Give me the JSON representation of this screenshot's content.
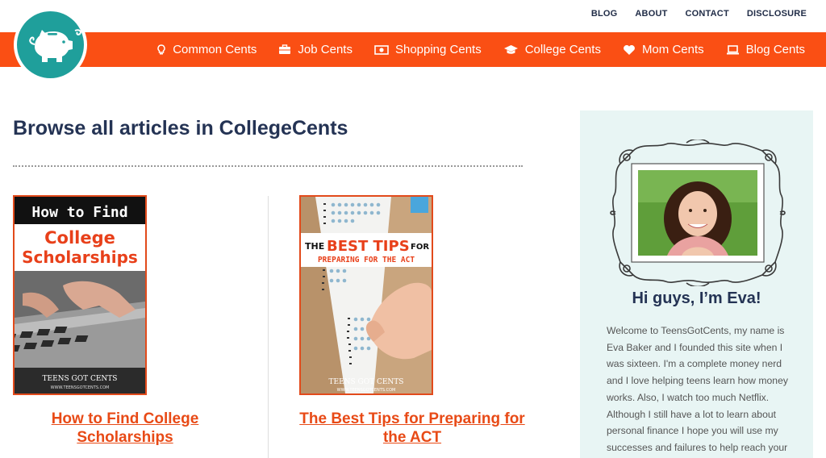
{
  "top_links": [
    "BLOG",
    "ABOUT",
    "CONTACT",
    "DISCLOSURE"
  ],
  "nav": [
    {
      "label": "Common Cents",
      "icon": "lightbulb-icon"
    },
    {
      "label": "Job Cents",
      "icon": "briefcase-icon"
    },
    {
      "label": "Shopping Cents",
      "icon": "money-icon"
    },
    {
      "label": "College Cents",
      "icon": "graduation-cap-icon"
    },
    {
      "label": "Mom Cents",
      "icon": "heart-icon"
    },
    {
      "label": "Blog Cents",
      "icon": "laptop-icon"
    }
  ],
  "colors": {
    "brand_orange": "#fa4f14",
    "logo_teal": "#1f9f9b",
    "title_navy": "#243354",
    "link_orange": "#e84a16",
    "sidebar_bg": "#e8f5f4"
  },
  "page_title": "Browse all articles in CollegeCents",
  "articles": [
    {
      "title": "How to Find College Scholarships",
      "image": {
        "line1": "How to Find",
        "line2": "College",
        "line3": "Scholarships",
        "brand": "TEENS GOT CENTS",
        "url": "WWW.TEENSGOTCENTS.COM"
      }
    },
    {
      "title": "The Best Tips for Preparing for the ACT",
      "image": {
        "the": "THE",
        "best_tips": "BEST TIPS",
        "for": "FOR",
        "line2": "PREPARING FOR THE ACT",
        "brand": "TEENS GOT CENTS",
        "url": "WWW.TEENSGOTCENTS.COM"
      }
    }
  ],
  "sidebar": {
    "heading": "Hi guys, I’m Eva!",
    "bio": "Welcome to TeensGotCents, my name is Eva Baker and I founded this site when I was sixteen. I'm a complete money nerd and I love helping teens learn how money works. Also, I watch too much Netflix. Although I still have a lot to learn about personal finance I hope you will use my successes and failures to help reach your"
  }
}
